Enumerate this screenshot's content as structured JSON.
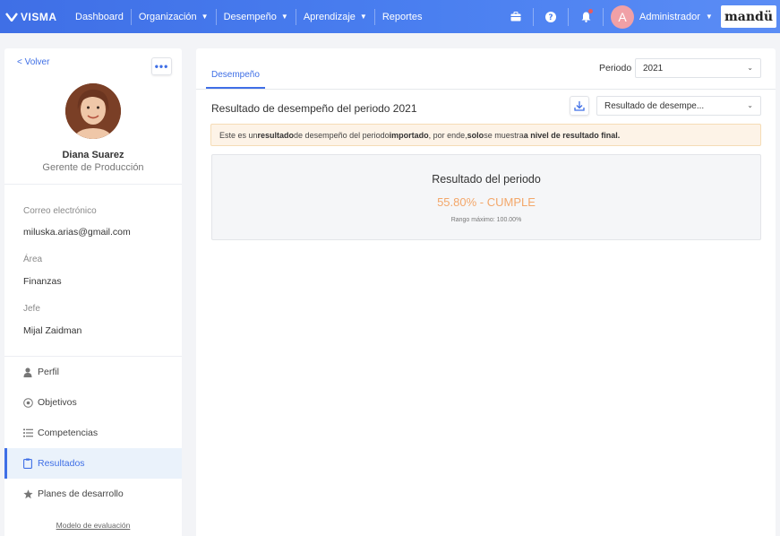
{
  "topbar": {
    "logo": "VISMA",
    "nav": [
      {
        "label": "Dashboard",
        "has_dropdown": false
      },
      {
        "label": "Organización",
        "has_dropdown": true
      },
      {
        "label": "Desempeño",
        "has_dropdown": true
      },
      {
        "label": "Aprendizaje",
        "has_dropdown": true
      },
      {
        "label": "Reportes",
        "has_dropdown": false
      }
    ],
    "icons": [
      "briefcase-icon",
      "help-icon",
      "bell-icon"
    ],
    "user": {
      "initial": "A",
      "name": "Administrador"
    },
    "brand": "mandü",
    "colors": {
      "accent": "#3f6fe6",
      "notification": "#e95b5b"
    }
  },
  "profile": {
    "back_label": "< Volver",
    "more_label": "•••",
    "name": "Diana Suarez",
    "role": "Gerente de Producción",
    "fields": [
      {
        "label": "Correo electrónico",
        "value": "miluska.arias@gmail.com"
      },
      {
        "label": "Área",
        "value": "Finanzas"
      },
      {
        "label": "Jefe",
        "value": "Mijal Zaidman"
      }
    ],
    "menu": [
      {
        "label": "Perfil",
        "icon": "person-icon",
        "active": false
      },
      {
        "label": "Objetivos",
        "icon": "target-icon",
        "active": false
      },
      {
        "label": "Competencias",
        "icon": "list-icon",
        "active": false
      },
      {
        "label": "Resultados",
        "icon": "clipboard-icon",
        "active": true
      },
      {
        "label": "Planes de desarrollo",
        "icon": "star-icon",
        "active": false
      }
    ],
    "eval_link": "Modelo de evaluación"
  },
  "main": {
    "tab": "Desempeño",
    "periodo_label": "Periodo",
    "periodo_value": "2021",
    "section_title": "Resultado de desempeño del periodo 2021",
    "result_select": "Resultado de desempe...",
    "notice": {
      "p1": "Este es un ",
      "b1": "resultado",
      "p2": " de desempeño del periodo ",
      "b2": "importado",
      "p3": ", por ende, ",
      "b3": "solo",
      "p4": " se muestra ",
      "b4": "a nivel de resultado final."
    },
    "result": {
      "title": "Resultado del periodo",
      "value": "55.80% - CUMPLE",
      "range": "Rango máximo: 100.00%",
      "value_color": "#f3a76a"
    }
  }
}
